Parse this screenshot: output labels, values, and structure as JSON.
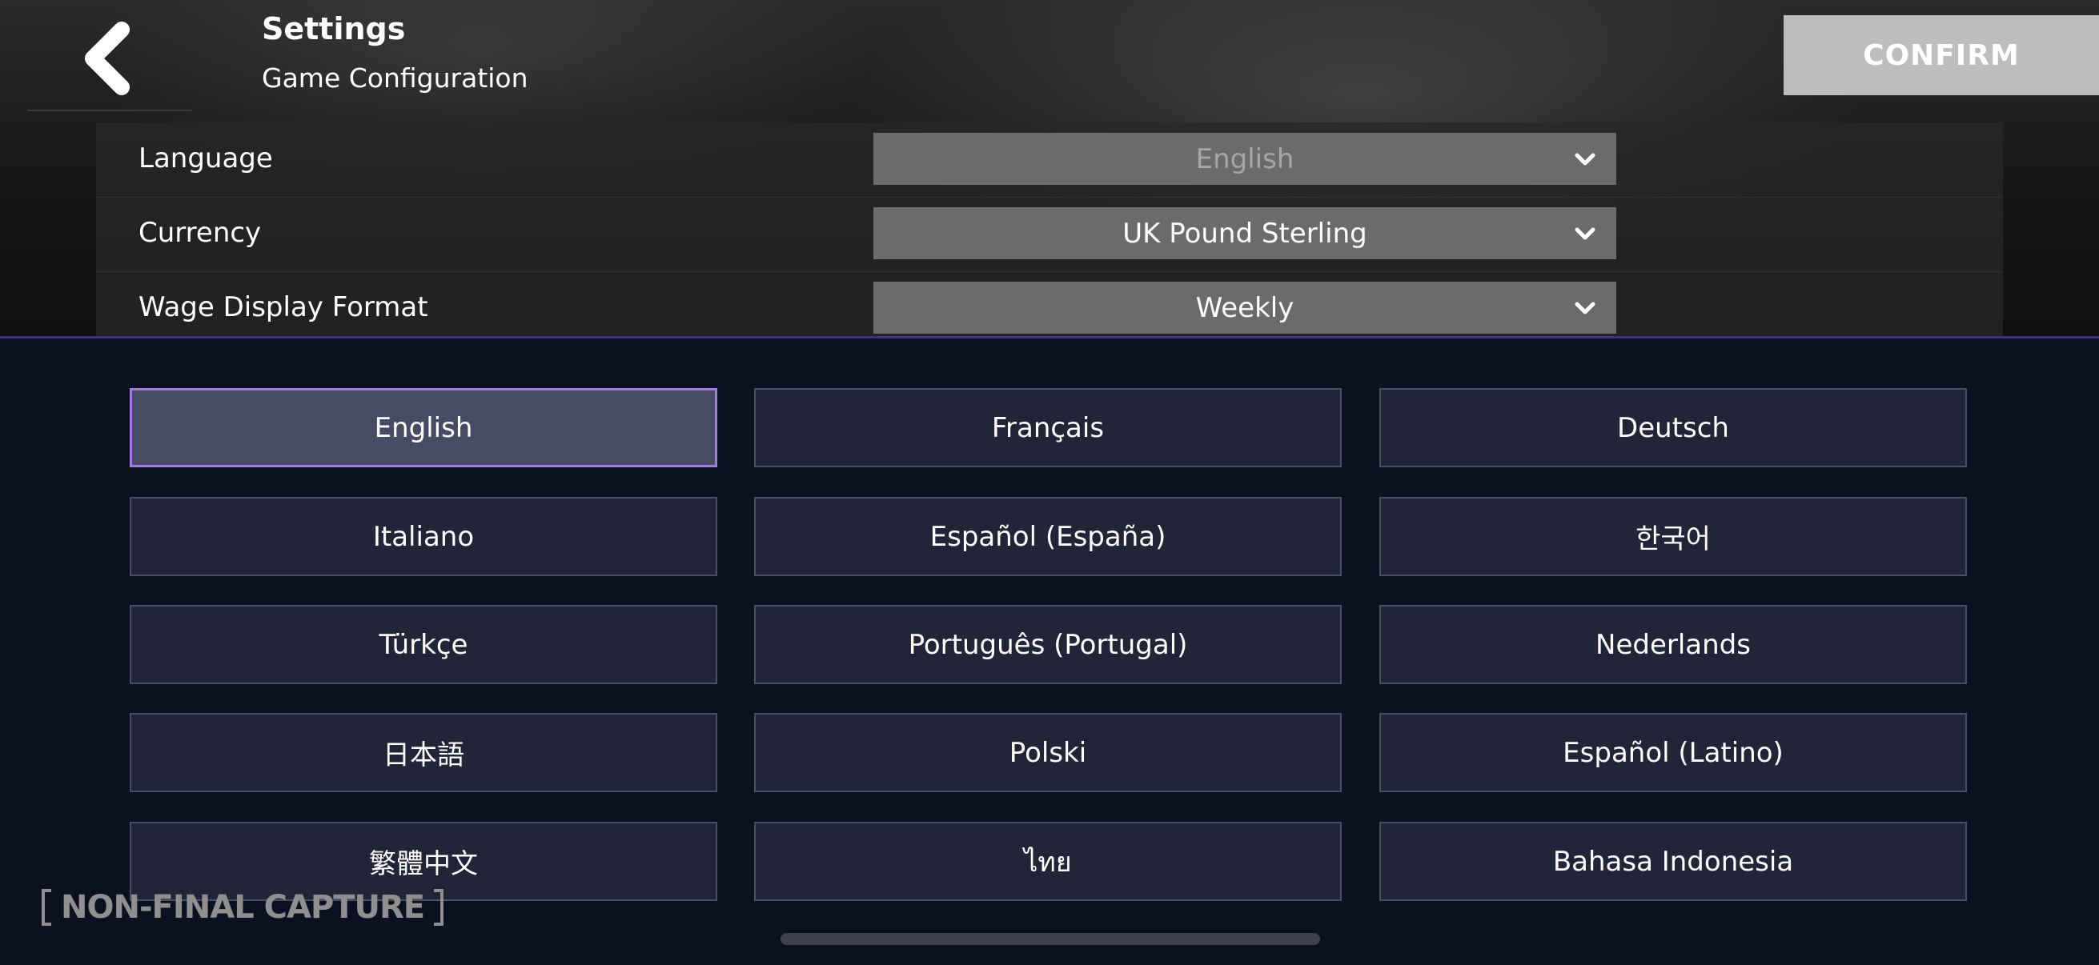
{
  "header": {
    "title": "Settings",
    "subtitle": "Game Configuration",
    "confirm_label": "CONFIRM",
    "back_icon": "chevron-left-icon"
  },
  "settings": [
    {
      "label": "Language",
      "value": "English"
    },
    {
      "label": "Currency",
      "value": "UK Pound Sterling"
    },
    {
      "label": "Wage Display Format",
      "value": "Weekly"
    }
  ],
  "languages": [
    "English",
    "Français",
    "Deutsch",
    "Italiano",
    "Español (España)",
    "한국어",
    "Türkçe",
    "Português (Portugal)",
    "Nederlands",
    "日本語",
    "Polski",
    "Español (Latino)",
    "繁體中文",
    "ไทย",
    "Bahasa Indonesia"
  ],
  "selected_language": "English",
  "watermark": "NON-FINAL CAPTURE",
  "colors": {
    "accent": "#a47be6",
    "confirm_bg": "#bdbdbd",
    "panel_bg": "#0b1120",
    "tile_bg": "#222537",
    "tile_selected_bg": "#474b63"
  }
}
